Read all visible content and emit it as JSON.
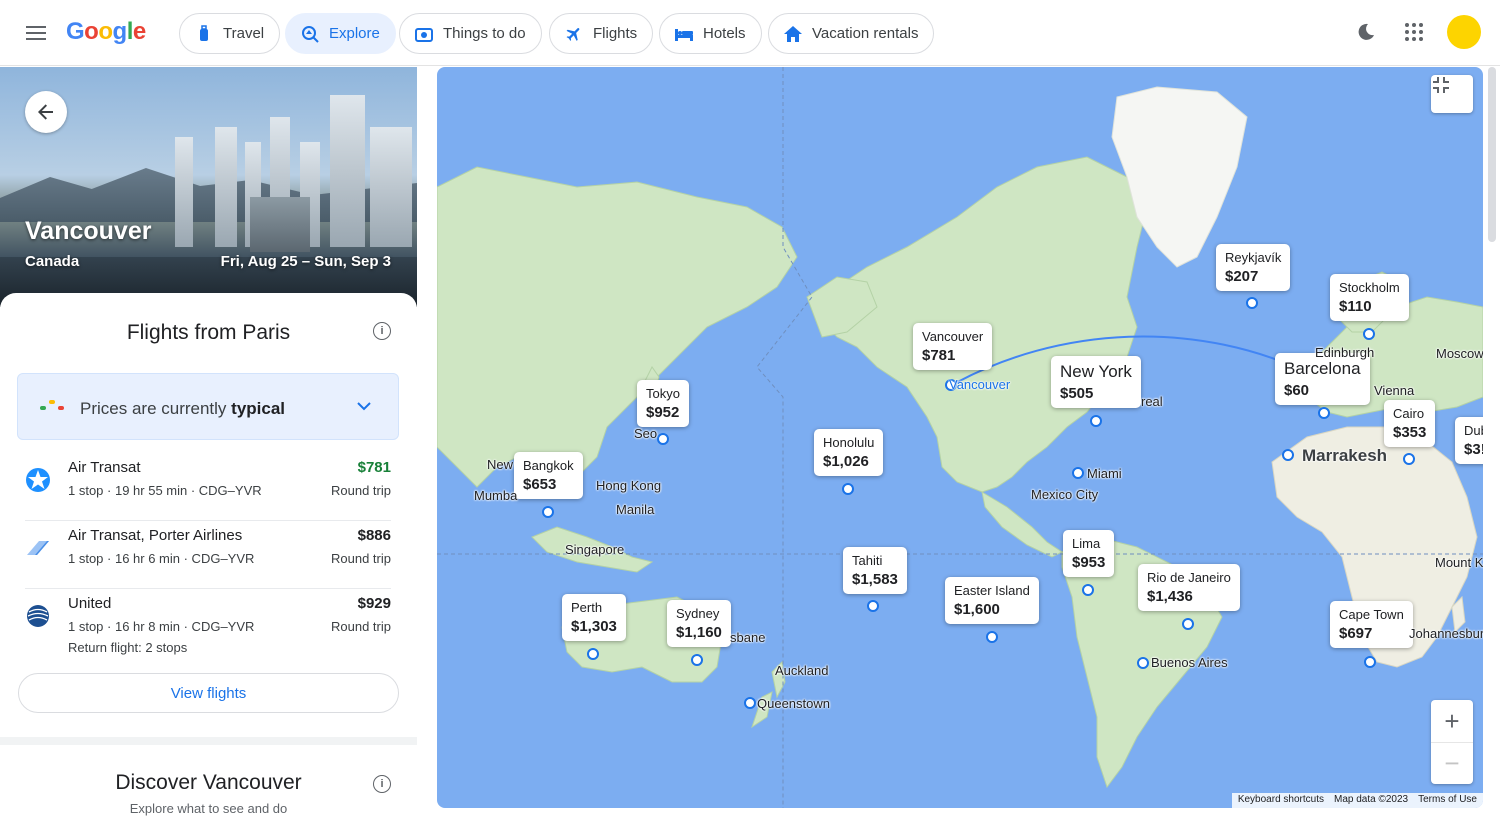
{
  "header": {
    "logo": "Google",
    "nav": [
      {
        "label": "Travel"
      },
      {
        "label": "Explore"
      },
      {
        "label": "Things to do"
      },
      {
        "label": "Flights"
      },
      {
        "label": "Hotels"
      },
      {
        "label": "Vacation rentals"
      }
    ],
    "active_tab": "Explore"
  },
  "destination": {
    "city": "Vancouver",
    "country": "Canada",
    "dates": "Fri, Aug 25 – Sun, Sep 3"
  },
  "flights_card": {
    "title": "Flights from Paris",
    "prices_text_prefix": "Prices are currently ",
    "prices_status": "typical",
    "flights": [
      {
        "airline": "Air Transat",
        "details": "1 stop · 19 hr 55 min · CDG–YVR",
        "price": "$781",
        "trip": "Round trip",
        "extra": ""
      },
      {
        "airline": "Air Transat, Porter Airlines",
        "details": "1 stop · 16 hr 6 min · CDG–YVR",
        "price": "$886",
        "trip": "Round trip",
        "extra": ""
      },
      {
        "airline": "United",
        "details": "1 stop · 16 hr 8 min · CDG–YVR",
        "price": "$929",
        "trip": "Round trip",
        "extra": "Return flight: 2 stops"
      }
    ],
    "view_flights": "View flights"
  },
  "discover_card": {
    "title": "Discover Vancouver",
    "subtitle": "Explore what to see and do"
  },
  "map": {
    "price_labels": [
      {
        "name": "Reykjavík",
        "price": "$207"
      },
      {
        "name": "Stockholm",
        "price": "$110"
      },
      {
        "name": "Vancouver",
        "price": "$781"
      },
      {
        "name": "New York",
        "price": "$505"
      },
      {
        "name": "Barcelona",
        "price": "$60"
      },
      {
        "name": "Cairo",
        "price": "$353"
      },
      {
        "name": "Dub",
        "price": "$3!"
      },
      {
        "name": "Tokyo",
        "price": "$952"
      },
      {
        "name": "Honolulu",
        "price": "$1,026"
      },
      {
        "name": "Bangkok",
        "price": "$653"
      },
      {
        "name": "Tahiti",
        "price": "$1,583"
      },
      {
        "name": "Lima",
        "price": "$953"
      },
      {
        "name": "Rio de Janeiro",
        "price": "$1,436"
      },
      {
        "name": "Easter Island",
        "price": "$1,600"
      },
      {
        "name": "Cape Town",
        "price": "$697"
      },
      {
        "name": "Perth",
        "price": "$1,303"
      },
      {
        "name": "Sydney",
        "price": "$1,160"
      }
    ],
    "place_names": {
      "vancouver": "Vancouver",
      "marrakesh": "Marrakesh",
      "miami": "Miami",
      "mexico_city": "Mexico City",
      "edinburgh": "Edinburgh",
      "moscow": "Moscow",
      "vienna": "Vienna",
      "montreal": "real",
      "seoul": "Seo",
      "new_delhi": "New",
      "mumbai": "Mumba",
      "hong_kong": "Hong Kong",
      "manila": "Manila",
      "singapore": "Singapore",
      "brisbane": "sbane",
      "auckland": "Auckland",
      "queenstown": "Queenstown",
      "buenos_aires": "Buenos Aires",
      "johannesburg": "Johannesbur",
      "mount_k": "Mount K"
    },
    "attribution": {
      "shortcuts": "Keyboard shortcuts",
      "data": "Map data ©2023",
      "terms": "Terms of Use"
    },
    "zoom_in": "+",
    "zoom_out": "−"
  },
  "colors": {
    "accent": "#1a73e8",
    "ocean": "#7cadf1",
    "land": "#cfe6c3",
    "cheap_price": "#188038",
    "avatar": "#fdd400"
  },
  "icons": [
    "menu-icon",
    "travel-icon",
    "explore-icon",
    "things-to-do-icon",
    "flights-icon",
    "hotels-icon",
    "vacation-rentals-icon",
    "dark-mode-icon",
    "apps-icon",
    "back-arrow-icon",
    "info-icon",
    "chevron-down-icon",
    "fullscreen-exit-icon",
    "airport-pin-icon"
  ]
}
